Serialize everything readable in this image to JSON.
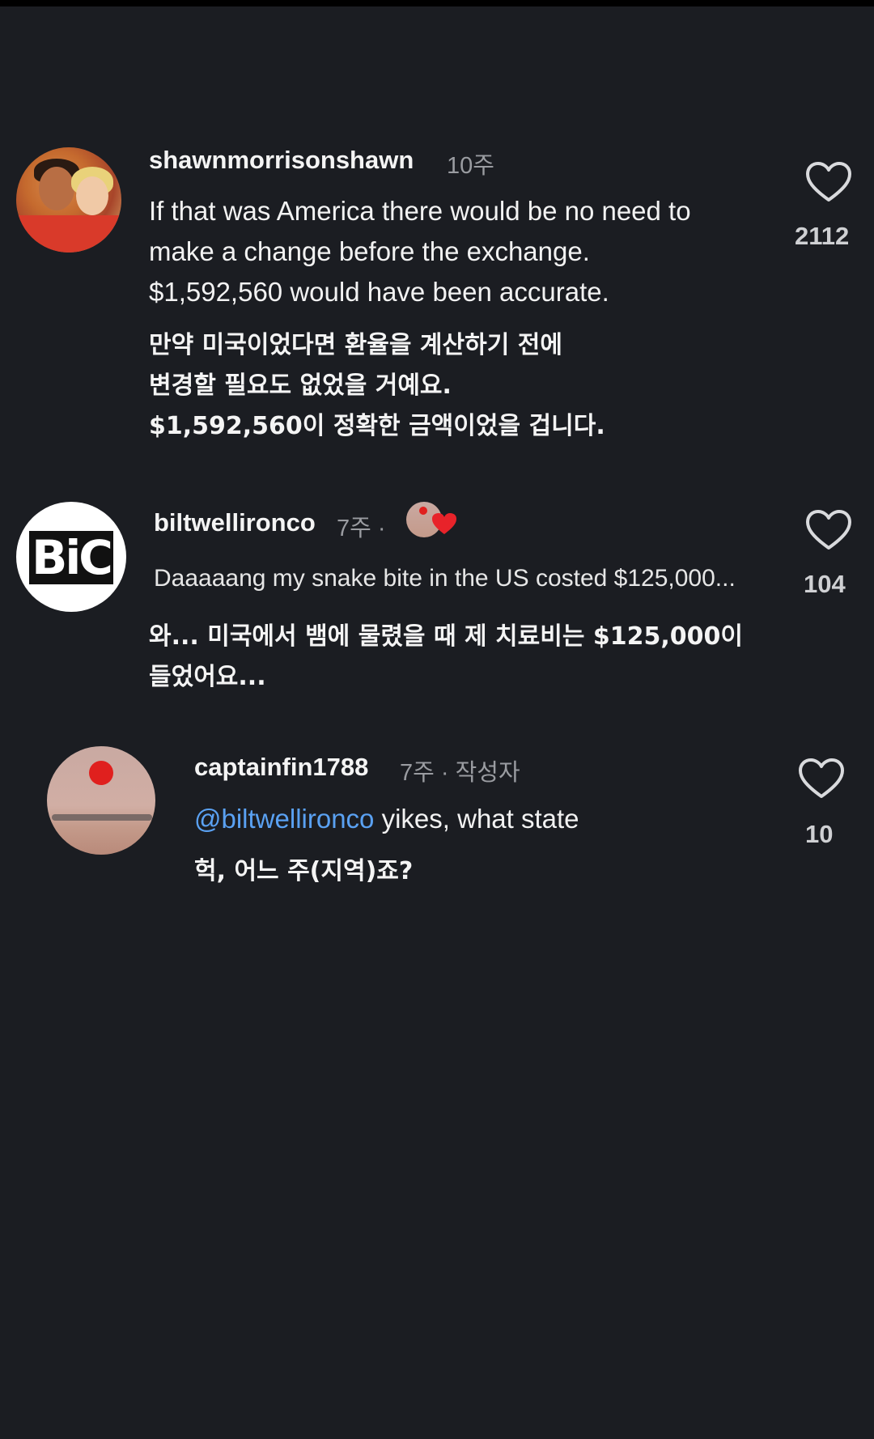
{
  "comments": [
    {
      "username": "shawnmorrisonshawn",
      "time": "10주",
      "text_en": [
        "If that was America there would be no need to",
        "make a change before the exchange.",
        "$1,592,560 would have been accurate."
      ],
      "text_ko": [
        "만약 미국이었다면 환율을 계산하기 전에",
        "변경할 필요도 없었을 거예요.",
        "$1,592,560이 정확한 금액이었을 겁니다."
      ],
      "likes": "2112",
      "avatar_icon": "profile-photo-couple"
    },
    {
      "username": "biltwellironco",
      "time": "7주 ·",
      "text_en": [
        "Daaaaang my snake bite in the US costed $125,000..."
      ],
      "text_ko": [
        "와... 미국에서 뱀에 물렸을 때 제 치료비는 $125,000이",
        "들었어요..."
      ],
      "likes": "104",
      "avatar_text": "BiC"
    },
    {
      "username": "captainfin1788",
      "time": "7주 · 작성자",
      "mention": "@biltwellironco",
      "text_en_rest": " yikes, what state",
      "text_ko": [
        "헉, 어느 주(지역)죠?"
      ],
      "likes": "10",
      "avatar_icon": "profile-photo-sunset"
    }
  ],
  "colors": {
    "background": "#1b1d22",
    "mention": "#5aa1f2",
    "liked_by_creator_heart": "#e8232a"
  }
}
